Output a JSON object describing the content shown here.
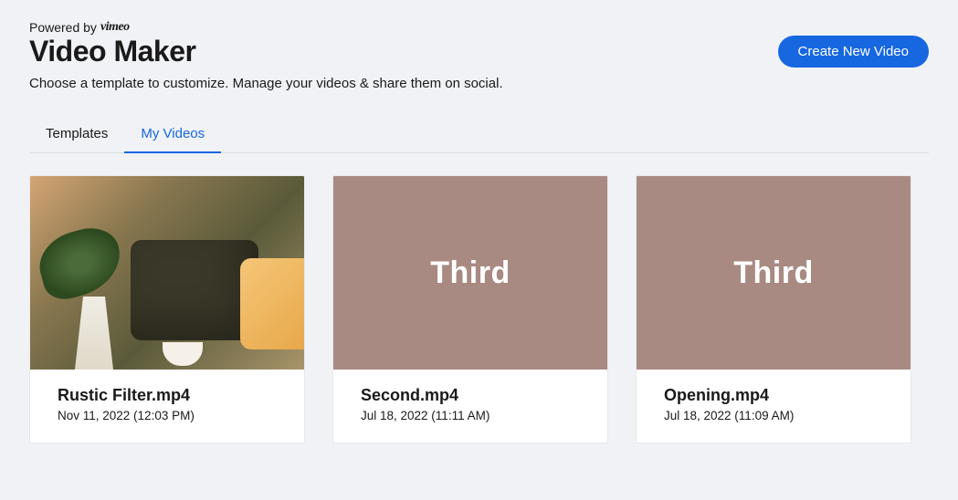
{
  "header": {
    "powered_by_text": "Powered by",
    "powered_by_brand": "vimeo",
    "title": "Video Maker",
    "subtitle": "Choose a template to customize. Manage your videos & share them on social.",
    "create_button": "Create New Video"
  },
  "tabs": {
    "templates": "Templates",
    "my_videos": "My Videos",
    "active": "my_videos"
  },
  "videos": [
    {
      "title": "Rustic Filter.mp4",
      "meta": "Nov 11, 2022 (12:03 PM)",
      "thumb_type": "photo",
      "thumb_label": ""
    },
    {
      "title": "Second.mp4",
      "meta": "Jul 18, 2022 (11:11 AM)",
      "thumb_type": "text",
      "thumb_label": "Third"
    },
    {
      "title": "Opening.mp4",
      "meta": "Jul 18, 2022 (11:09 AM)",
      "thumb_type": "text",
      "thumb_label": "Third"
    }
  ],
  "colors": {
    "accent": "#1767e1",
    "thumb_bg": "#a98a82"
  }
}
